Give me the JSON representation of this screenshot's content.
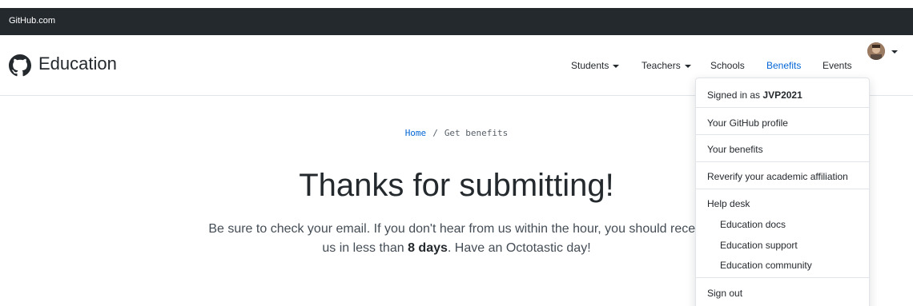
{
  "topbar": {
    "site": "GitHub.com"
  },
  "header": {
    "title": "Education"
  },
  "nav": {
    "students": "Students",
    "teachers": "Teachers",
    "schools": "Schools",
    "benefits": "Benefits",
    "events": "Events"
  },
  "breadcrumb": {
    "home": "Home",
    "separator": "/",
    "current": "Get benefits"
  },
  "main": {
    "headline": "Thanks for submitting!",
    "line1": "Be sure to check your email. If you don't hear from us within the hour, you should receiv",
    "line2_pre": "us in less than ",
    "line2_bold": "8 days",
    "line2_post": ". Have an Octotastic day!"
  },
  "menu": {
    "signed_in_prefix": "Signed in as ",
    "username": "JVP2021",
    "profile": "Your GitHub profile",
    "benefits": "Your benefits",
    "reverify": "Reverify your academic affiliation",
    "help_desk": "Help desk",
    "docs": "Education docs",
    "support": "Education support",
    "community": "Education community",
    "sign_out": "Sign out"
  }
}
